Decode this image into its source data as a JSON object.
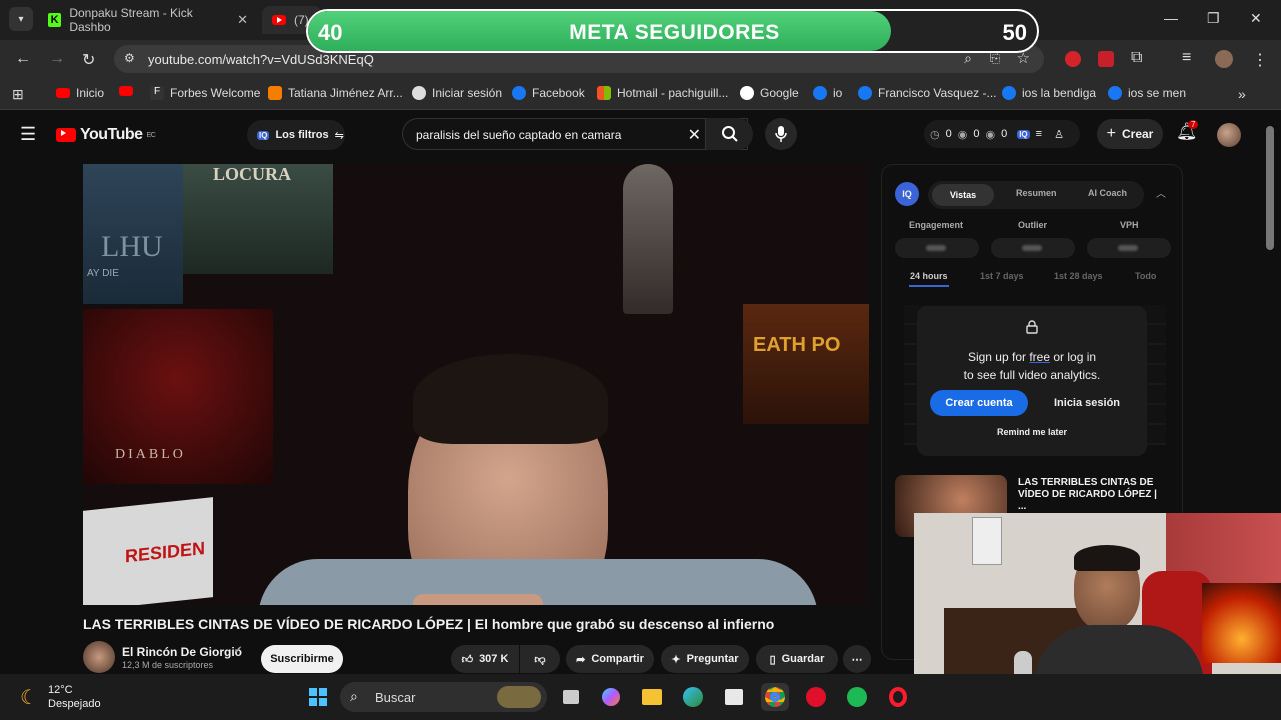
{
  "tabs": [
    {
      "label": "Donpaku Stream - Kick Dashbo"
    },
    {
      "label": "(7)"
    }
  ],
  "goal": {
    "current": "40",
    "target": "50",
    "label": "META SEGUIDORES",
    "progress": 0.8
  },
  "address": {
    "url": "youtube.com/watch?v=VdUSd3KNEqQ"
  },
  "bookmarks": [
    {
      "label": "Inicio",
      "icon": "youtube-icon"
    },
    {
      "label": "",
      "icon": "youtube-icon"
    },
    {
      "label": "Forbes Welcome",
      "icon": "forbes-icon"
    },
    {
      "label": "Tatiana Jiménez Arr...",
      "icon": "blogger-icon"
    },
    {
      "label": "Iniciar sesión",
      "icon": "steam-icon"
    },
    {
      "label": "Facebook",
      "icon": "facebook-icon"
    },
    {
      "label": "Hotmail - pachiguill...",
      "icon": "windows-icon"
    },
    {
      "label": "Google",
      "icon": "google-icon"
    },
    {
      "label": "io",
      "icon": "facebook-icon"
    },
    {
      "label": "Francisco Vasquez -...",
      "icon": "facebook-icon"
    },
    {
      "label": "ios la bendiga",
      "icon": "facebook-icon"
    },
    {
      "label": "ios se men",
      "icon": "facebook-icon"
    }
  ],
  "yt": {
    "logo": "YouTube",
    "country": "EC",
    "filters_label": "Los filtros",
    "search_query": "paralisis del sueño captado en camara",
    "stats": [
      "0",
      "0",
      "0"
    ],
    "create_label": "Crear",
    "notif_count": "7"
  },
  "video": {
    "title": "LAS TERRIBLES CINTAS DE VÍDEO DE RICARDO LÓPEZ | El hombre que grabó su descenso al infierno",
    "poster_top": "LOCURA",
    "poster_mid": "LHU",
    "poster_sub": "AY DIE",
    "poster_diablo": "DIABLO",
    "poster_right": "EATH PO",
    "sign": "RESIDEN",
    "channel": "El Rincón De Giorgio",
    "subs": "12,3 M de suscriptores",
    "subscribe": "Suscribirme",
    "likes": "307 K",
    "share": "Compartir",
    "ask": "Preguntar",
    "save": "Guardar"
  },
  "panel": {
    "tabs": [
      "Vistas",
      "Resumen",
      "AI Coach"
    ],
    "metrics": [
      "Engagement",
      "Outlier",
      "VPH"
    ],
    "ranges": [
      "24 hours",
      "1st 7 days",
      "1st 28 days",
      "Todo"
    ],
    "signin_line1": "Sign up for ",
    "signin_free": "free",
    "signin_line1b": " or log in",
    "signin_line2": "to see full video analytics.",
    "create_account": "Crear cuenta",
    "login": "Inicia sesión",
    "remind": "Remind me later"
  },
  "rec": {
    "title": "LAS TERRIBLES CINTAS DE VÍDEO DE RICARDO LÓPEZ | ..."
  },
  "weather": {
    "temp": "12°C",
    "desc": "Despejado"
  },
  "taskbar": {
    "search": "Buscar"
  }
}
